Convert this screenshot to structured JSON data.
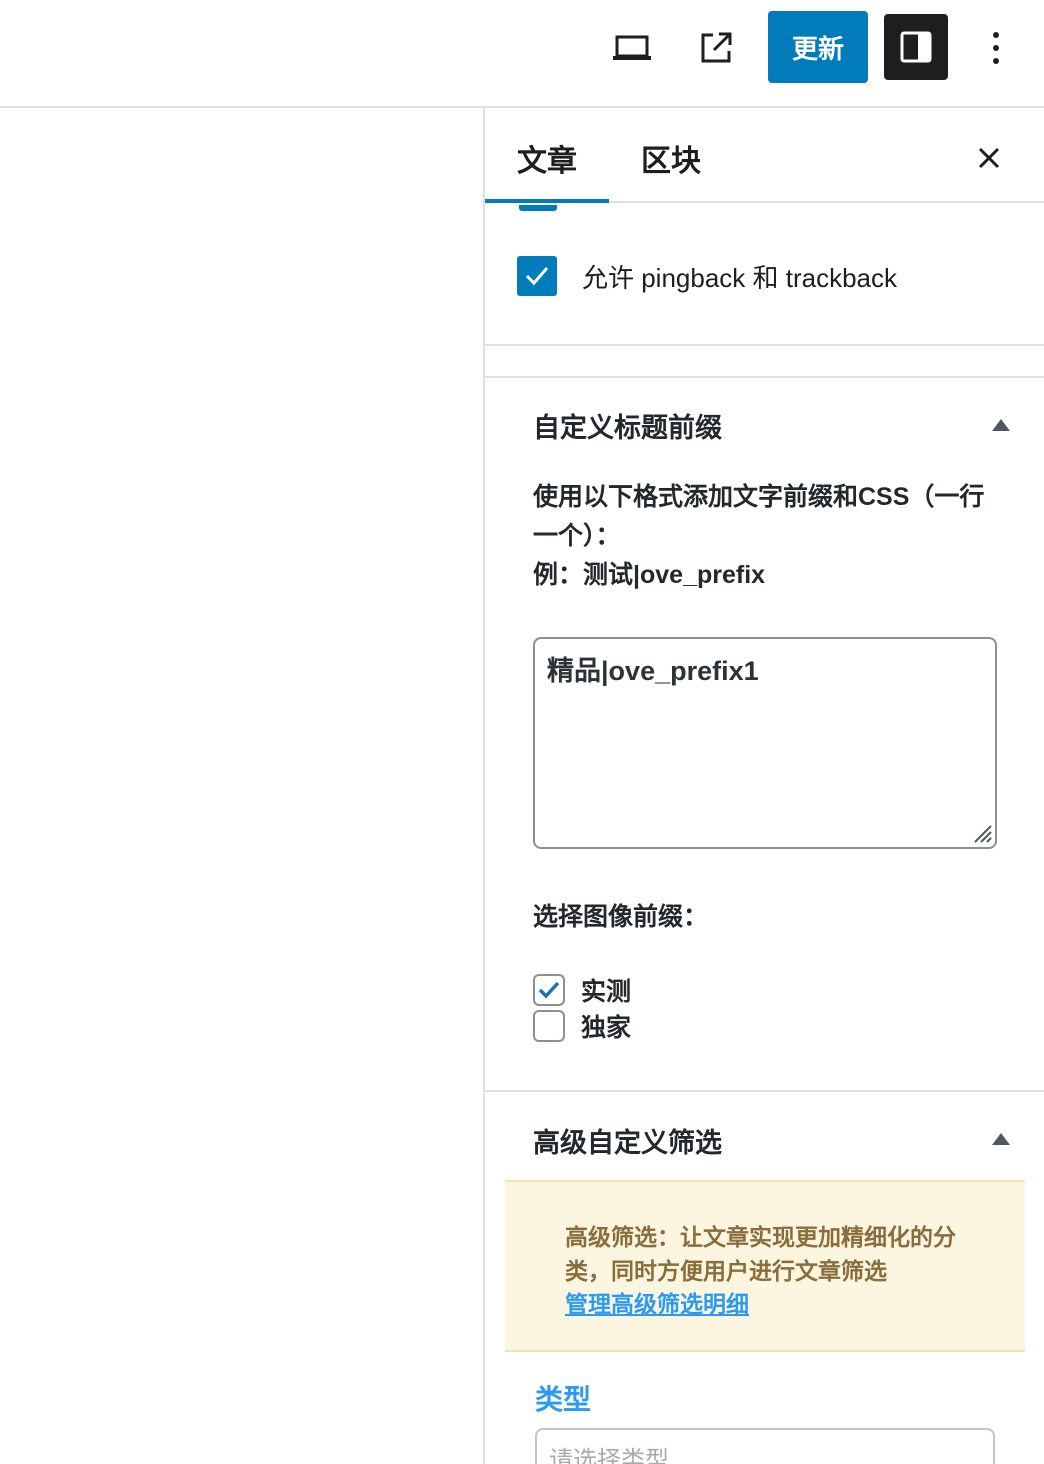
{
  "toolbar": {
    "preview_icon": "laptop-icon",
    "view_post_icon": "external-link-icon",
    "update_label": "更新",
    "settings_icon": "sidebar-toggle-icon",
    "more_icon": "more-vertical-icon"
  },
  "sidebar": {
    "tabs": [
      {
        "label": "文章",
        "active": true
      },
      {
        "label": "区块",
        "active": false
      }
    ],
    "close_icon": "close-icon",
    "discussion": {
      "pingback_label": "允许 pingback 和 trackback",
      "pingback_checked": true
    },
    "custom_prefix_panel": {
      "title": "自定义标题前缀",
      "toggle_icon": "triangle-up-icon",
      "description_line1": "使用以下格式添加文字前缀和CSS（一行一个）：",
      "description_line2": "例：测试|ove_prefix",
      "textarea_value": "精品|ove_prefix1",
      "image_prefix_label": "选择图像前缀：",
      "options": [
        {
          "label": "实测",
          "checked": true
        },
        {
          "label": "独家",
          "checked": false
        }
      ]
    },
    "advanced_filter_panel": {
      "title": "高级自定义筛选",
      "toggle_icon": "triangle-up-icon",
      "notice_text": "高级筛选：让文章实现更加精细化的分类，同时方便用户进行文章筛选",
      "notice_link": "管理高级筛选明细",
      "type_label": "类型",
      "type_placeholder": "请选择类型"
    }
  },
  "colors": {
    "accent": "#007cba",
    "link": "#2b9af3",
    "notice_bg": "#fcf6e1",
    "notice_text": "#8a6d3b"
  }
}
